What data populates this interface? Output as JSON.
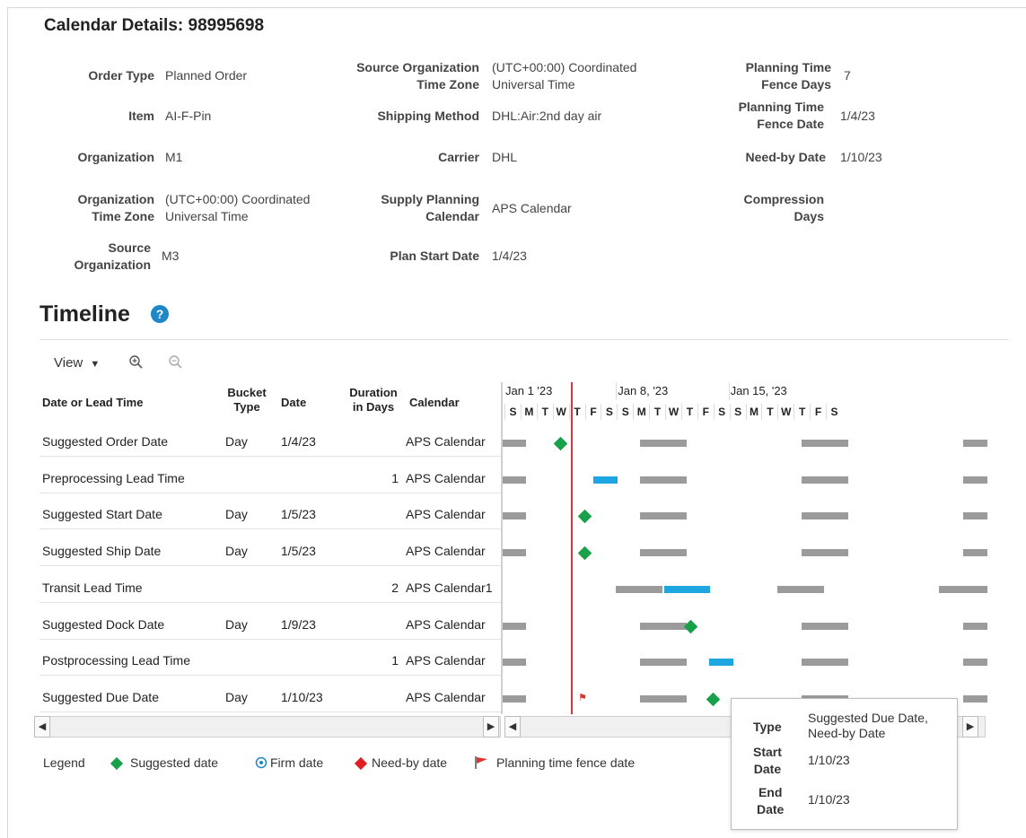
{
  "title": "Calendar Details: 98995698",
  "details": {
    "order_type_label": "Order Type",
    "order_type": "Planned Order",
    "item_label": "Item",
    "item": "AI-F-Pin",
    "organization_label": "Organization",
    "organization": "M1",
    "org_tz_label_1": "Organization",
    "org_tz_label_2": "Time Zone",
    "org_tz_1": "(UTC+00:00) Coordinated",
    "org_tz_2": "Universal Time",
    "source_org_label_1": "Source",
    "source_org_label_2": "Organization",
    "source_org": "M3",
    "src_tz_label_1": "Source Organization",
    "src_tz_label_2": "Time Zone",
    "src_tz_1": "(UTC+00:00) Coordinated",
    "src_tz_2": "Universal Time",
    "shipping_label": "Shipping Method",
    "shipping": "DHL:Air:2nd day air",
    "carrier_label": "Carrier",
    "carrier": "DHL",
    "supply_cal_label_1": "Supply Planning",
    "supply_cal_label_2": "Calendar",
    "supply_cal": "APS Calendar",
    "plan_start_label": "Plan Start Date",
    "plan_start": "1/4/23",
    "ptf_days_label_1": "Planning Time",
    "ptf_days_label_2": "Fence Days",
    "ptf_days": "7",
    "ptf_date_label_1": "Planning Time",
    "ptf_date_label_2": "Fence Date",
    "ptf_date": "1/4/23",
    "need_by_label": "Need-by Date",
    "need_by": "1/10/23",
    "compression_label_1": "Compression",
    "compression_label_2": "Days"
  },
  "timeline": {
    "title": "Timeline",
    "help_icon": "question-circle-icon",
    "view_label": "View",
    "headers": {
      "name": "Date or Lead Time",
      "bucket_1": "Bucket",
      "bucket_2": "Type",
      "date": "Date",
      "duration_1": "Duration",
      "duration_2": "in Days",
      "calendar": "Calendar"
    },
    "rows": [
      {
        "name": "Suggested Order Date",
        "bucket": "Day",
        "date": "1/4/23",
        "duration": "",
        "calendar": "APS Calendar"
      },
      {
        "name": "Preprocessing Lead Time",
        "bucket": "",
        "date": "",
        "duration": "1",
        "calendar": "APS Calendar"
      },
      {
        "name": "Suggested Start Date",
        "bucket": "Day",
        "date": "1/5/23",
        "duration": "",
        "calendar": "APS Calendar"
      },
      {
        "name": "Suggested Ship Date",
        "bucket": "Day",
        "date": "1/5/23",
        "duration": "",
        "calendar": "APS Calendar"
      },
      {
        "name": "Transit Lead Time",
        "bucket": "",
        "date": "",
        "duration": "2",
        "calendar": "APS Calendar1"
      },
      {
        "name": "Suggested Dock Date",
        "bucket": "Day",
        "date": "1/9/23",
        "duration": "",
        "calendar": "APS Calendar"
      },
      {
        "name": "Postprocessing Lead Time",
        "bucket": "",
        "date": "",
        "duration": "1",
        "calendar": "APS Calendar"
      },
      {
        "name": "Suggested Due Date",
        "bucket": "Day",
        "date": "1/10/23",
        "duration": "",
        "calendar": "APS Calendar"
      }
    ],
    "weeks": [
      "Jan 1 '23",
      "Jan 8, '23",
      "Jan 15, '23"
    ],
    "days": [
      "S",
      "M",
      "T",
      "W",
      "T",
      "F",
      "S",
      "S",
      "M",
      "T",
      "W",
      "T",
      "F",
      "S",
      "S",
      "M",
      "T",
      "W",
      "T",
      "F",
      "S"
    ]
  },
  "legend": {
    "label": "Legend",
    "suggested": "Suggested date",
    "firm": "Firm date",
    "need_by": "Need-by date",
    "ptf": "Planning time fence date",
    "colors": {
      "suggested": "#18a04a",
      "firm": "#1e87c8",
      "need_by": "#e02020",
      "ptf": "#d33"
    }
  },
  "tooltip": {
    "type_label": "Type",
    "type_1": "Suggested Due Date,",
    "type_2": "Need-by Date",
    "start_label_1": "Start",
    "start_label_2": "Date",
    "start": "1/10/23",
    "end_label_1": "End",
    "end_label_2": "Date",
    "end": "1/10/23"
  },
  "colors": {
    "bar_grey": "#9b9b9b",
    "bar_blue": "#1ea6e0",
    "today_line": "#e03434"
  }
}
